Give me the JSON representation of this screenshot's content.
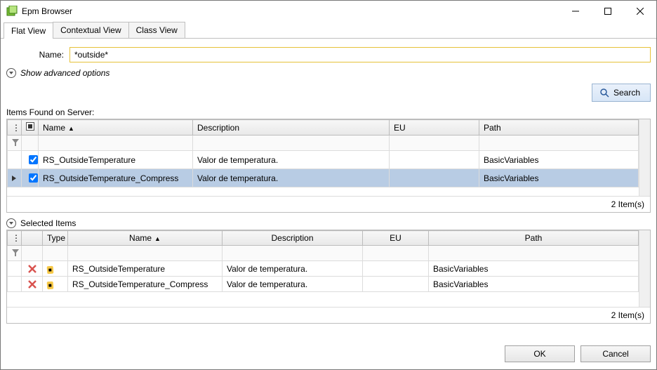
{
  "window": {
    "title": "Epm Browser"
  },
  "tabs": [
    {
      "label": "Flat View",
      "active": true
    },
    {
      "label": "Contextual View",
      "active": false
    },
    {
      "label": "Class View",
      "active": false
    }
  ],
  "filter": {
    "name_label": "Name:",
    "name_value": "*outside*",
    "advanced_label": "Show advanced options"
  },
  "search_button": "Search",
  "found": {
    "label": "Items Found on Server:",
    "columns": {
      "name": "Name",
      "description": "Description",
      "eu": "EU",
      "path": "Path"
    },
    "rows": [
      {
        "checked": true,
        "name": "RS_OutsideTemperature",
        "description": "Valor de temperatura.",
        "eu": "",
        "path": "BasicVariables",
        "selected": false
      },
      {
        "checked": true,
        "name": "RS_OutsideTemperature_Compress",
        "description": "Valor de temperatura.",
        "eu": "",
        "path": "BasicVariables",
        "selected": true
      }
    ],
    "count_text": "2 Item(s)"
  },
  "selected": {
    "label": "Selected Items",
    "columns": {
      "type": "Type",
      "name": "Name",
      "description": "Description",
      "eu": "EU",
      "path": "Path"
    },
    "rows": [
      {
        "name": "RS_OutsideTemperature",
        "description": "Valor de temperatura.",
        "eu": "",
        "path": "BasicVariables"
      },
      {
        "name": "RS_OutsideTemperature_Compress",
        "description": "Valor de temperatura.",
        "eu": "",
        "path": "BasicVariables"
      }
    ],
    "count_text": "2 Item(s)"
  },
  "dialog_buttons": {
    "ok": "OK",
    "cancel": "Cancel"
  }
}
